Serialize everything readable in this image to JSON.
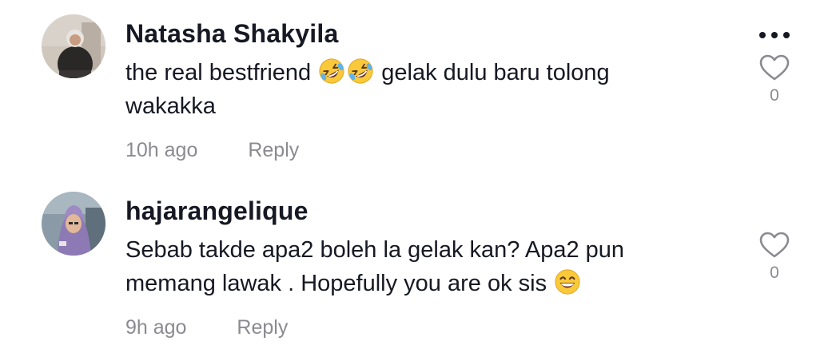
{
  "comments": [
    {
      "username": "Natasha Shakyila",
      "text_line1": "the real bestfriend",
      "text_line1_after": "gelak dulu baru tolong",
      "text_line2": "wakakka",
      "time": "10h ago",
      "reply_label": "Reply",
      "like_count": "0",
      "emojis": [
        "rolling-on-floor-laughing",
        "rolling-on-floor-laughing"
      ]
    },
    {
      "username": "hajarangelique",
      "text_line1": "Sebab takde apa2 boleh la gelak kan? Apa2 pun",
      "text_line2": "memang lawak . Hopefully you are ok sis",
      "time": "9h ago",
      "reply_label": "Reply",
      "like_count": "0",
      "emojis": [
        "grinning-face-with-smiling-eyes"
      ]
    }
  ],
  "colors": {
    "text": "#161823",
    "secondary": "#8a8b91",
    "icon": "#8a8b91"
  }
}
